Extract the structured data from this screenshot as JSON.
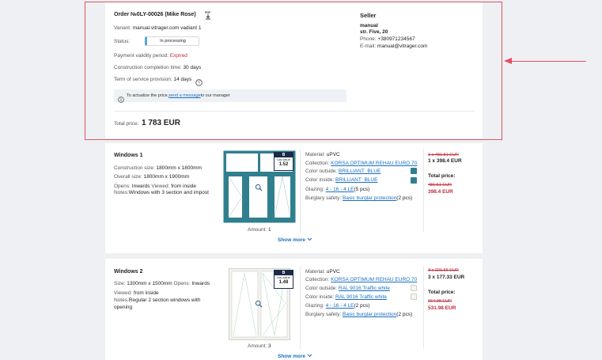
{
  "order": {
    "title": "Order №0LY-00026 (Mike Rose)",
    "pdf_icon": "pdf-download-icon",
    "variant_label": "Variant:",
    "variant_value": "manual.vitrager.com vadiant 1",
    "status_label": "Status:",
    "status_value": "In processing",
    "payment_label": "Payment validity period:",
    "payment_value": "Expired",
    "construction_label": "Construction completion time:",
    "construction_value": "30 days",
    "term_label": "Term of service provision:",
    "term_value": "14 days",
    "info_text_prefix": "To actualize the price,",
    "info_link": "send a message",
    "info_text_suffix": "to our manager",
    "total_label": "Total price:",
    "total_value": "1 783 EUR"
  },
  "seller": {
    "heading": "Seller",
    "name": "manual",
    "address": "str. Five, 20",
    "phone_label": "Phone:",
    "phone_value": "+380971234567",
    "email_label": "E-mail:",
    "email_value": "manual@vitrager.com"
  },
  "items": [
    {
      "title": "Windows 1",
      "construction_label": "Construction size:",
      "construction_value": "1800mm x 1800mm",
      "overall_label": "Overall size:",
      "overall_value": "1800mm x 1900mm",
      "opens_label": "Opens:",
      "opens_value": "Inwards",
      "viewed_label": "Viewed:",
      "viewed_value": "from inside",
      "notes_label": "Notes:",
      "notes_value": "Windows with 3 section and impost",
      "uw_class": "B",
      "uw_label": "Uw-value",
      "uw_value": "1.52",
      "amount_label": "Amount:",
      "amount_value": "1",
      "material_label": "Material:",
      "material_value": "uPVC",
      "collection_label": "Collection:",
      "collection_value": "KORSA OPTIMUM REHAU EURO 70",
      "color_out_label": "Color outside:",
      "color_out_value": "BRILLIANT_BLUE",
      "color_in_label": "Color inside:",
      "color_in_value": "BRILLIANT_BLUE",
      "glazing_label": "Glazing:",
      "glazing_value": "4 - 16 - 4 LE",
      "glazing_count": "(5 pcs)",
      "burglary_label": "Burglary safety:",
      "burglary_value": "Basic burglar protection",
      "burglary_count": "(2 pcs)",
      "old_unit": "1 x 481.51 EUR",
      "new_unit": "1 x 398.4 EUR",
      "total_label": "Total price:",
      "old_total": "481.51 EUR",
      "new_total": "398.4 EUR",
      "show_more": "Show more",
      "swatch_out": "#2f7f8f",
      "swatch_in": "#2f7f8f"
    },
    {
      "title": "Windows 2",
      "size_label": "Size:",
      "size_value": "1300mm x 1500mm",
      "opens_label": "Opens:",
      "opens_value": "Inwards",
      "viewed_label": "Viewed:",
      "viewed_value": "from inside",
      "notes_label": "Notes:",
      "notes_line1": "Regular 2 section windows with",
      "notes_line2": "opening",
      "uw_class": "B",
      "uw_label": "Uw-value",
      "uw_value": "1.48",
      "amount_label": "Amount:",
      "amount_value": "3",
      "material_label": "Material:",
      "material_value": "uPVC",
      "collection_label": "Collection:",
      "collection_value": "KORSA OPTIMUM REHAU EURO 70",
      "color_out_label": "Color outside:",
      "color_out_value": "RAL 9016 Traffic white",
      "color_in_label": "Color inside:",
      "color_in_value": "RAL 9016 Traffic white",
      "glazing_label": "Glazing:",
      "glazing_value": "4 - 16 - 4 LE",
      "glazing_count": "(2 pcs)",
      "burglary_label": "Burglary safety:",
      "burglary_value": "Basic burglar protection",
      "burglary_count": "(2 pcs)",
      "old_unit": "3 x 221.66 EUR",
      "new_unit": "3 x 177.33 EUR",
      "total_label": "Total price:",
      "old_total": "664.98 EUR",
      "new_total": "531.98 EUR",
      "show_more": "Show more",
      "swatch_out": "#f4f4f0",
      "swatch_in": "#f4f4f0"
    }
  ],
  "colors": {
    "accent_link": "#1a6fc0",
    "price_red": "#c0283a",
    "highlight_frame": "#e0525f"
  }
}
